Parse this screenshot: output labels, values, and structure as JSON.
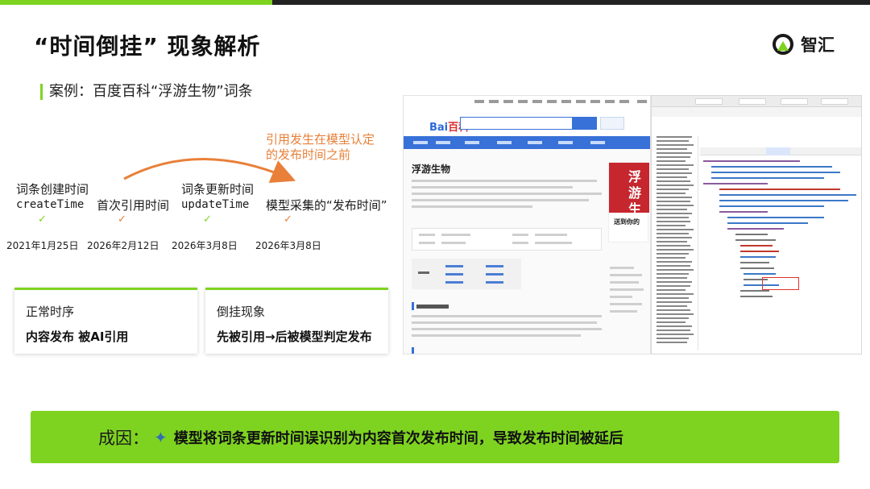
{
  "page": {
    "title": "“时间倒挂” 现象解析",
    "brand": "智汇",
    "case_label": "案例：百度百科“浮游生物”词条"
  },
  "timeline": {
    "arc_label": "引用发生在模型认定的发布时间之前",
    "events": [
      {
        "label": "词条创建时间",
        "code": "createTime",
        "date": "2021年1月25日",
        "status": "green"
      },
      {
        "label": "首次引用时间",
        "code": "",
        "date": "2026年2月12日",
        "status": "orange"
      },
      {
        "label": "词条更新时间",
        "code": "updateTime",
        "date": "2026年3月8日",
        "status": "green"
      },
      {
        "label": "模型采集的“发布时间”",
        "code": "",
        "date": "2026年3月8日",
        "status": "orange"
      }
    ]
  },
  "cards": [
    {
      "title": "正常时序",
      "body": "内容发布 被AI引用"
    },
    {
      "title": "倒挂现象",
      "body": "先被引用→后被模型判定发布"
    }
  ],
  "screenshot": {
    "baidu_logo_left": "Bai",
    "baidu_logo_right": "百科",
    "entry_title": "浮游生物",
    "poster_text": "浮游生物",
    "poster_caption": "送到你的"
  },
  "banner": {
    "label": "成因：",
    "icon": "sparkle-icon",
    "text": "模型将词条更新时间误识别为内容首次发布时间，导致发布时间被延后"
  },
  "colors": {
    "accent_green": "#7ed321",
    "accent_orange": "#e8803a",
    "baidu_blue": "#3871d8",
    "highlight_red": "#e0312d"
  }
}
